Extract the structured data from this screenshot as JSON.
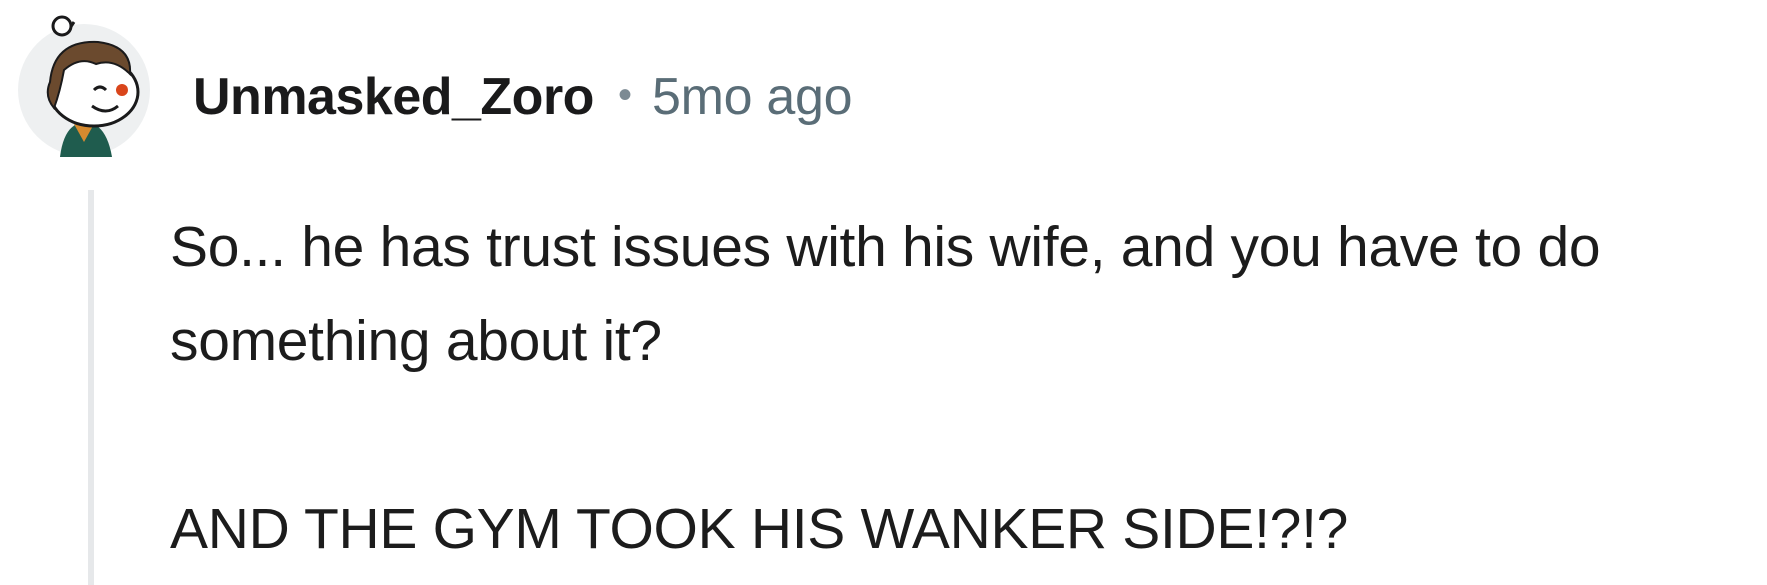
{
  "comment": {
    "author": "Unmasked_Zoro",
    "separator": "•",
    "timestamp": "5mo ago",
    "avatar_icon": "snoo-avatar-icon",
    "paragraphs": [
      "So... he has trust issues with his wife, and you have to do something about it?",
      "AND THE GYM TOOK HIS WANKER SIDE!?!?"
    ]
  },
  "colors": {
    "username": "#1a1a1b",
    "timestamp": "#5a6d77",
    "thread_line": "#e6e8ea",
    "avatar_bg": "#eef0f1"
  }
}
